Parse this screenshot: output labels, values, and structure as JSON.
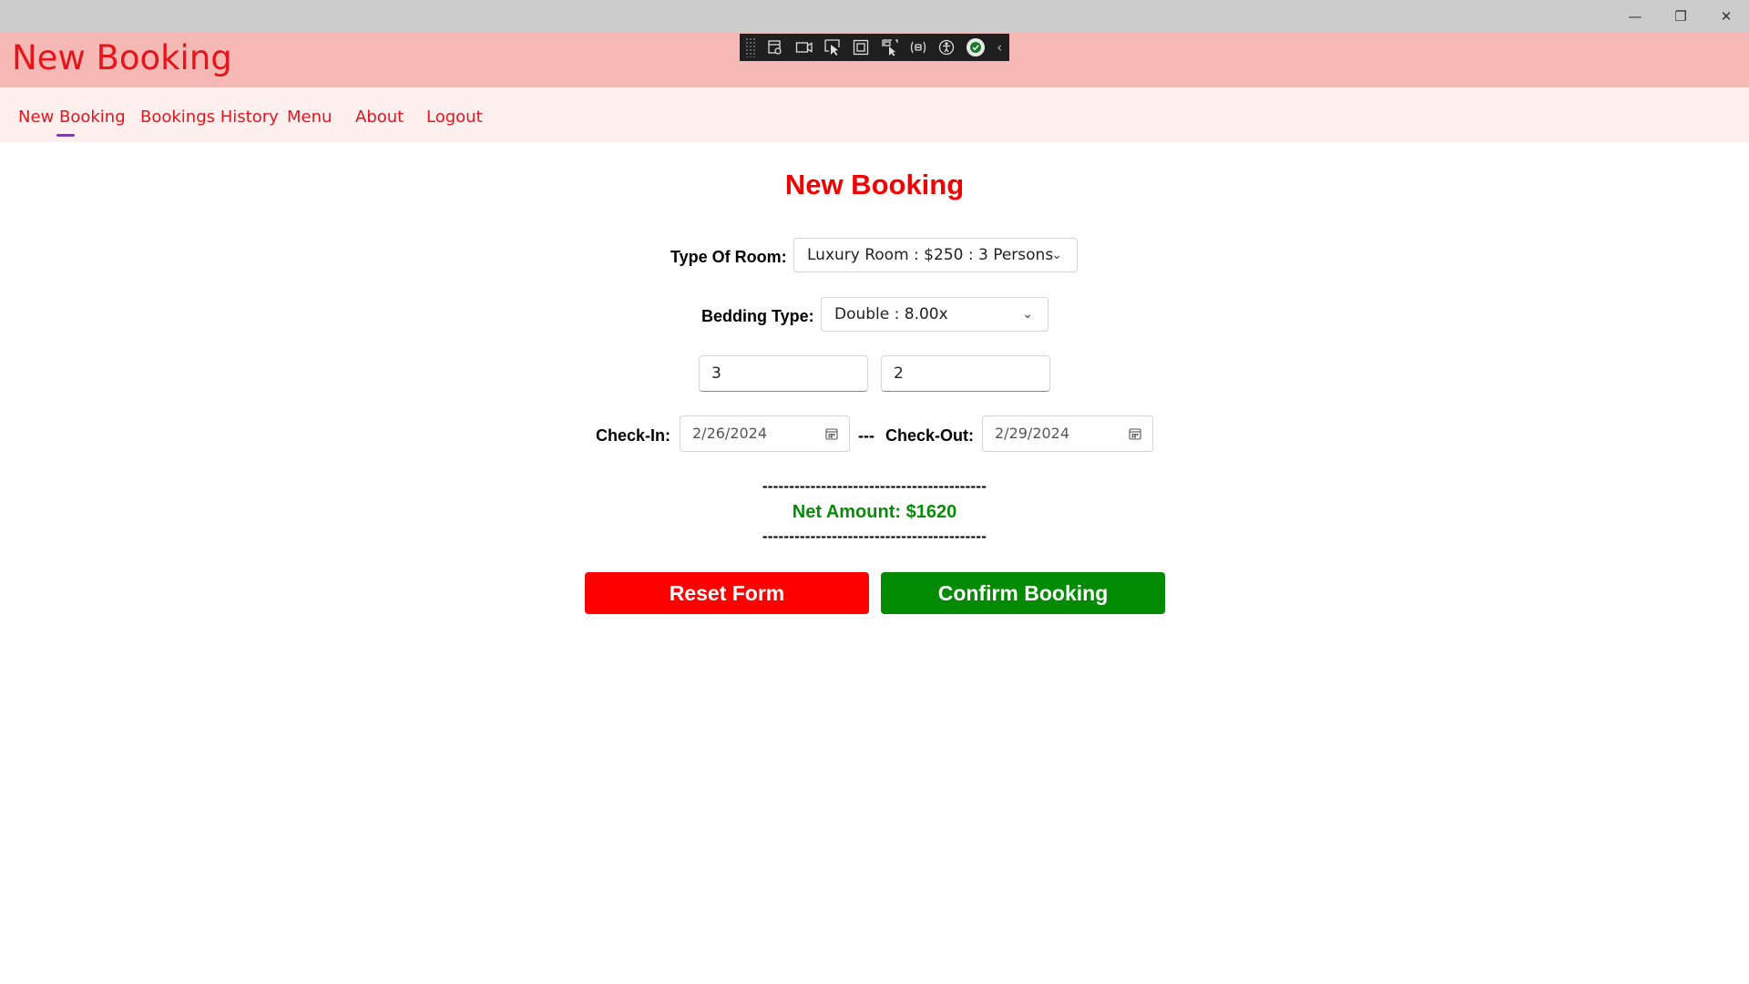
{
  "window": {
    "minimize_glyph": "—",
    "restore_glyph": "❐",
    "close_glyph": "✕"
  },
  "app": {
    "title": "New Booking"
  },
  "debug_toolbar": {
    "icons": [
      "live-visual-tree-icon",
      "record-icon",
      "select-element-icon",
      "display-layout-adorners-icon",
      "track-focus-icon",
      "binding-failures-icon",
      "accessibility-icon",
      "hot-reload-ok-icon"
    ],
    "collapse_glyph": "‹"
  },
  "nav": {
    "items": [
      {
        "label": "New Booking",
        "active": true
      },
      {
        "label": "Bookings History"
      },
      {
        "label": "Menu"
      },
      {
        "label": "About"
      },
      {
        "label": "Logout"
      }
    ],
    "active_indicator_color": "#8a2be2"
  },
  "form": {
    "heading": "New Booking",
    "room_type": {
      "label": "Type Of Room:",
      "value": "Luxury Room : $250 : 3 Persons"
    },
    "bedding_type": {
      "label": "Bedding Type:",
      "value": "Double : 8.00x"
    },
    "field_a": "3",
    "field_b": "2",
    "check_in": {
      "label": "Check-In:",
      "value": "2/26/2024"
    },
    "separator": "---",
    "check_out": {
      "label": "Check-Out:",
      "value": "2/29/2024"
    },
    "dashes": "------------------------------------------",
    "net_amount": "Net Amount: $1620",
    "reset_label": "Reset Form",
    "confirm_label": "Confirm Booking"
  },
  "colors": {
    "title_red": "#e8141c",
    "heading_red": "#f00000",
    "reset_red": "#ff0000",
    "confirm_green": "#028a02",
    "net_green": "#0a8a0a",
    "appbar_pink": "#f5b8b4",
    "nav_pink": "#fff0ef"
  }
}
